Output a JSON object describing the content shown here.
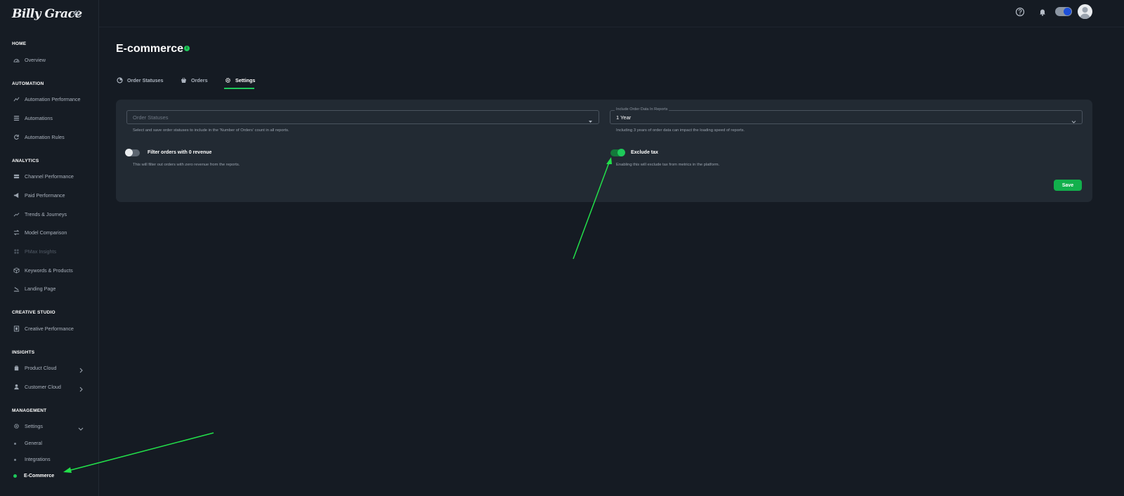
{
  "brand": {
    "logo_text": "Billy Grace"
  },
  "sidebar": {
    "sections": [
      {
        "title": "HOME"
      },
      {
        "title": "AUTOMATION"
      },
      {
        "title": "ANALYTICS"
      },
      {
        "title": "CREATIVE STUDIO"
      },
      {
        "title": "INSIGHTS"
      },
      {
        "title": "MANAGEMENT"
      }
    ],
    "items": [
      {
        "label": "Overview",
        "icon": "dashboard-icon"
      },
      {
        "label": "Automation Performance",
        "icon": "chart-line-icon"
      },
      {
        "label": "Automations",
        "icon": "list-icon"
      },
      {
        "label": "Automation Rules",
        "icon": "refresh-icon"
      },
      {
        "label": "Channel Performance",
        "icon": "signpost-icon"
      },
      {
        "label": "Paid Performance",
        "icon": "megaphone-icon"
      },
      {
        "label": "Trends & Journeys",
        "icon": "trend-icon"
      },
      {
        "label": "Model Comparison",
        "icon": "swap-icon"
      },
      {
        "label": "PMax Insights",
        "icon": "grid-icon",
        "disabled": true
      },
      {
        "label": "Keywords & Products",
        "icon": "box-icon"
      },
      {
        "label": "Landing Page",
        "icon": "landing-icon"
      },
      {
        "label": "Creative Performance",
        "icon": "image-icon"
      },
      {
        "label": "Product Cloud",
        "icon": "bag-icon"
      },
      {
        "label": "Customer Cloud",
        "icon": "user-icon"
      },
      {
        "label": "Settings",
        "icon": "gear-icon"
      }
    ],
    "sub_items": [
      {
        "label": "General"
      },
      {
        "label": "Integrations"
      },
      {
        "label": "E-Commerce",
        "active": true
      }
    ]
  },
  "topbar": {
    "icons": [
      "help-icon",
      "bell-icon",
      "theme-toggle",
      "avatar"
    ]
  },
  "page": {
    "title": "E-commerce",
    "info_badge": "i"
  },
  "tabs": [
    {
      "label": "Order Statuses",
      "icon": "status-icon"
    },
    {
      "label": "Orders",
      "icon": "basket-icon"
    },
    {
      "label": "Settings",
      "icon": "gear-icon",
      "active": true
    }
  ],
  "settings": {
    "order_statuses": {
      "placeholder": "Order Statuses",
      "helper": "Select and save order statuses to include in the 'Number of Orders' count in all reports."
    },
    "order_data": {
      "label": "Include Order Data In Reports",
      "value": "1 Year",
      "helper": "Including 3 years of order data can impact the loading speed of reports."
    },
    "filter_zero_revenue": {
      "label": "Filter orders with 0 revenue",
      "helper": "This will filter out orders with zero revenue from the reports.",
      "enabled": false
    },
    "exclude_tax": {
      "label": "Exclude tax",
      "helper": "Enabling this will exclude tax from metrics in the platform.",
      "enabled": true
    },
    "save_label": "Save"
  },
  "colors": {
    "accent": "#1ec95a",
    "background": "#151b23",
    "card": "#222a33",
    "annotation_arrow": "#22e04a"
  }
}
